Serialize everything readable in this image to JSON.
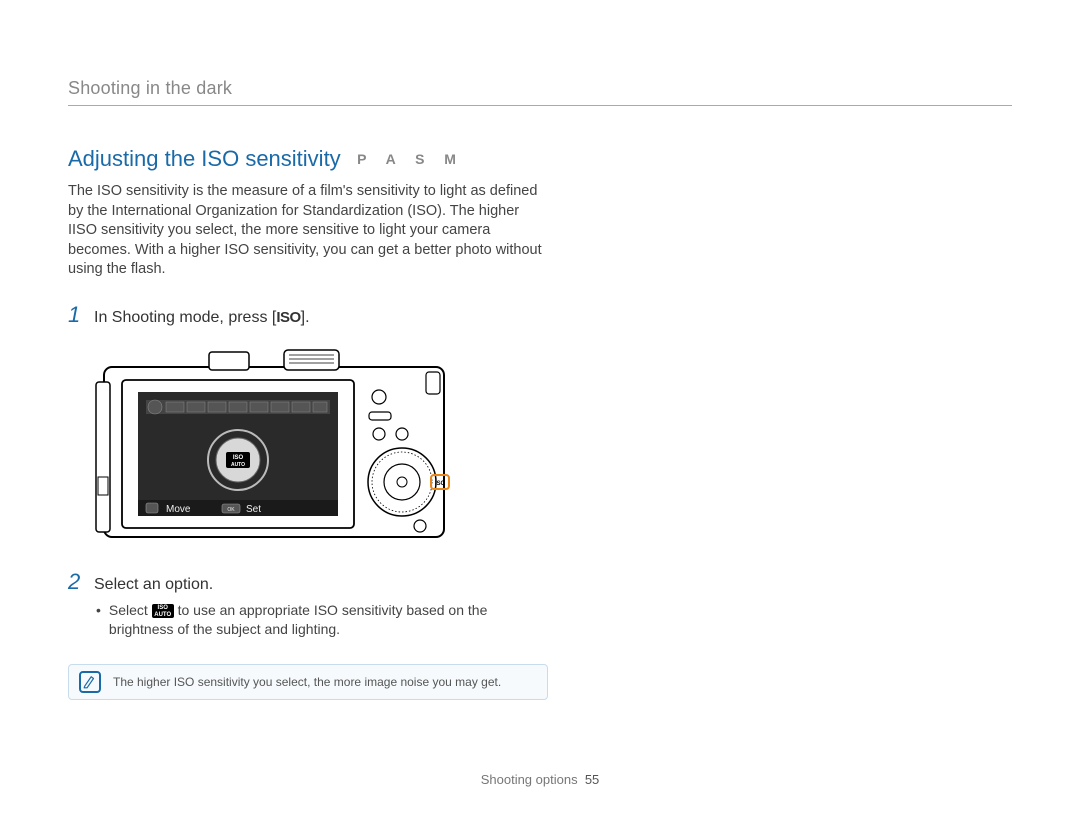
{
  "breadcrumb": "Shooting in the dark",
  "section": {
    "title": "Adjusting the ISO sensitivity",
    "modes": "P A S M",
    "intro": "The ISO sensitivity is the measure of a film's sensitivity to light as defined by the International Organization for Standardization (ISO). The higher IISO sensitivity you select, the more sensitive to light your camera becomes. With a higher ISO sensitivity, you can get a better photo without using the flash."
  },
  "steps": [
    {
      "num": "1",
      "prefix": "In Shooting mode, press [",
      "icon_label": "ISO",
      "suffix": "]."
    },
    {
      "num": "2",
      "text": "Select an option.",
      "bullet_prefix": "Select ",
      "bullet_icon_top": "ISO",
      "bullet_icon_bottom": "AUTO",
      "bullet_suffix": " to use an appropriate ISO sensitivity based on the brightness of the subject and lighting."
    }
  ],
  "camera_labels": {
    "move": "Move",
    "set": "Set",
    "center_top": "ISO",
    "center_bottom": "AUTO"
  },
  "note": {
    "text": "The higher ISO sensitivity you select, the more image noise you may get."
  },
  "footer": {
    "label": "Shooting options",
    "page": "55"
  }
}
